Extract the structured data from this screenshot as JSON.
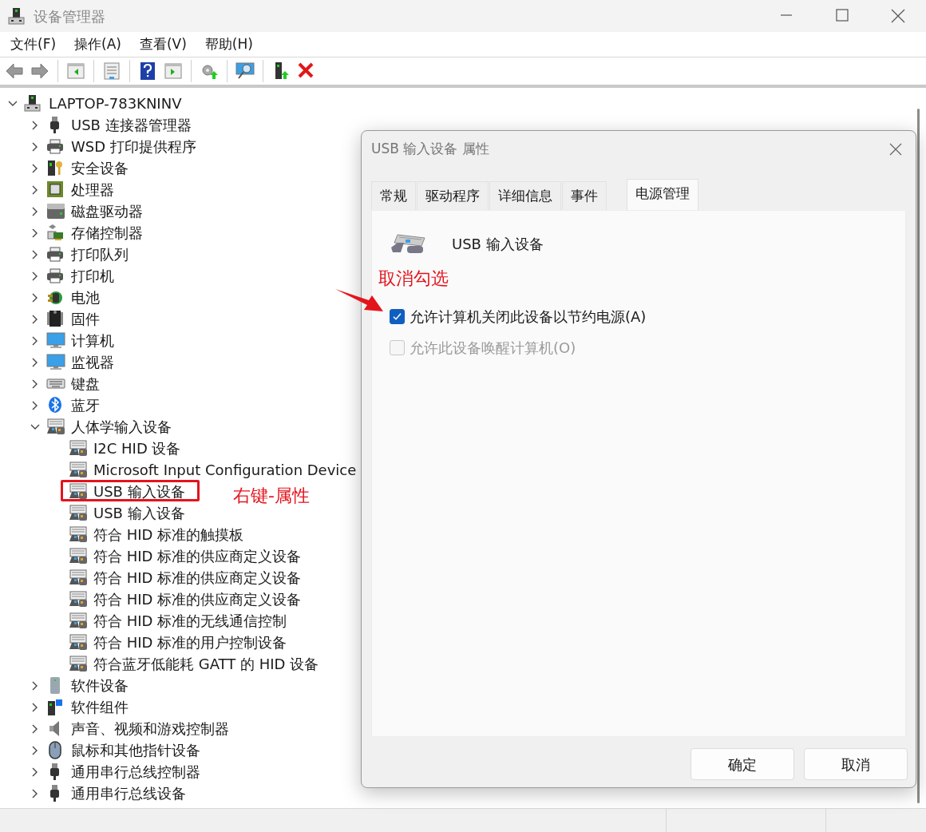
{
  "window": {
    "title": "设备管理器"
  },
  "menu": [
    {
      "label": "文件(F)"
    },
    {
      "label": "操作(A)"
    },
    {
      "label": "查看(V)"
    },
    {
      "label": "帮助(H)"
    }
  ],
  "tree": {
    "label": "LAPTOP-783KNINV",
    "expanded": true,
    "children": [
      {
        "label": "USB 连接器管理器",
        "expanded": false
      },
      {
        "label": "WSD 打印提供程序",
        "expanded": false
      },
      {
        "label": "安全设备",
        "expanded": false
      },
      {
        "label": "处理器",
        "expanded": false
      },
      {
        "label": "磁盘驱动器",
        "expanded": false
      },
      {
        "label": "存储控制器",
        "expanded": false
      },
      {
        "label": "打印队列",
        "expanded": false
      },
      {
        "label": "打印机",
        "expanded": false
      },
      {
        "label": "电池",
        "expanded": false
      },
      {
        "label": "固件",
        "expanded": false
      },
      {
        "label": "计算机",
        "expanded": false
      },
      {
        "label": "监视器",
        "expanded": false
      },
      {
        "label": "键盘",
        "expanded": false
      },
      {
        "label": "蓝牙",
        "expanded": false
      },
      {
        "label": "人体学输入设备",
        "expanded": true,
        "children": [
          {
            "label": "I2C HID 设备",
            "marked": false
          },
          {
            "label": "Microsoft Input Configuration Device",
            "marked": false
          },
          {
            "label": "USB 输入设备",
            "marked": true,
            "note": "右键-属性"
          },
          {
            "label": "USB 输入设备",
            "marked": false
          },
          {
            "label": "符合 HID 标准的触摸板",
            "marked": false
          },
          {
            "label": "符合 HID 标准的供应商定义设备",
            "marked": false
          },
          {
            "label": "符合 HID 标准的供应商定义设备",
            "marked": false
          },
          {
            "label": "符合 HID 标准的供应商定义设备",
            "marked": false
          },
          {
            "label": "符合 HID 标准的无线通信控制",
            "marked": false
          },
          {
            "label": "符合 HID 标准的用户控制设备",
            "marked": false
          },
          {
            "label": "符合蓝牙低能耗 GATT 的 HID 设备",
            "marked": false
          }
        ]
      },
      {
        "label": "软件设备",
        "expanded": false
      },
      {
        "label": "软件组件",
        "expanded": false
      },
      {
        "label": "声音、视频和游戏控制器",
        "expanded": false
      },
      {
        "label": "鼠标和其他指针设备",
        "expanded": false
      },
      {
        "label": "通用串行总线控制器",
        "expanded": false
      },
      {
        "label": "通用串行总线设备",
        "expanded": false
      }
    ]
  },
  "dialog": {
    "title": "USB 输入设备 属性",
    "tabs": [
      {
        "label": "常规",
        "selected": false
      },
      {
        "label": "驱动程序",
        "selected": false
      },
      {
        "label": "详细信息",
        "selected": false
      },
      {
        "label": "事件",
        "selected": false
      },
      {
        "label": "电源管理",
        "selected": true
      }
    ],
    "device_name": "USB 输入设备",
    "note": "取消勾选",
    "options": [
      {
        "label": "允许计算机关闭此设备以节约电源(A)",
        "checked": true,
        "disabled": false,
        "arrow": true
      },
      {
        "label": "允许此设备唤醒计算机(O)",
        "checked": false,
        "disabled": true,
        "arrow": false
      }
    ],
    "buttons": [
      {
        "label": "确定"
      },
      {
        "label": "取消"
      }
    ]
  }
}
